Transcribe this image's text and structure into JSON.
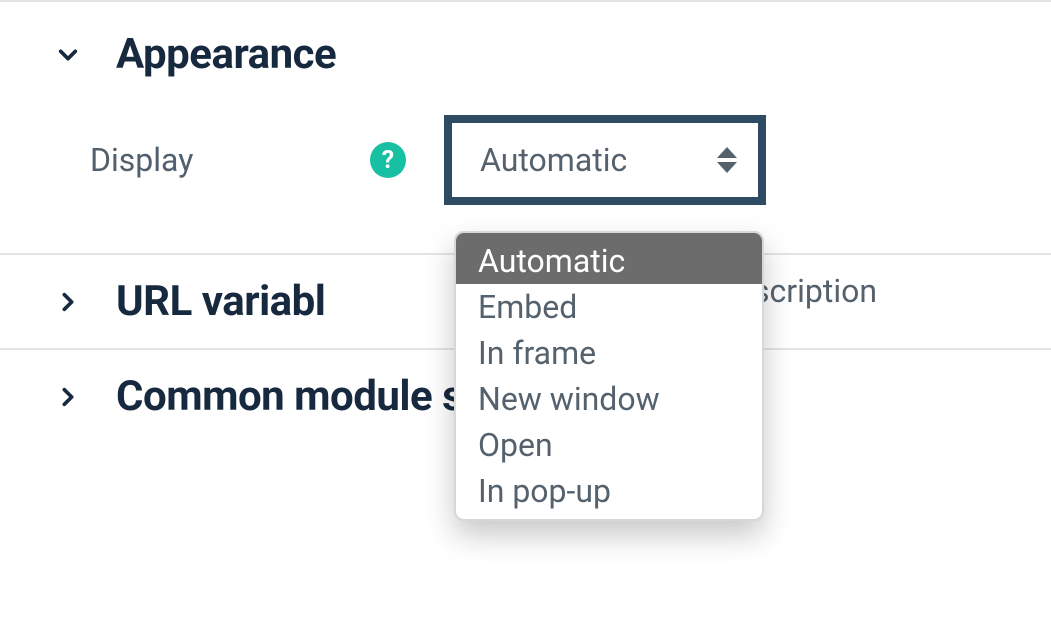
{
  "sections": {
    "appearance": {
      "title": "Appearance",
      "expanded": true,
      "fields": {
        "display": {
          "label": "Display",
          "selected": "Automatic",
          "options": [
            "Automatic",
            "Embed",
            "In frame",
            "New window",
            "Open",
            "In pop-up"
          ]
        }
      },
      "partial_text_fragment": "scription"
    },
    "url_variables": {
      "title": "URL variabl",
      "expanded": false
    },
    "common_module_settings": {
      "title": "Common module settings",
      "expanded": false
    }
  },
  "icons": {
    "help_glyph": "?"
  }
}
